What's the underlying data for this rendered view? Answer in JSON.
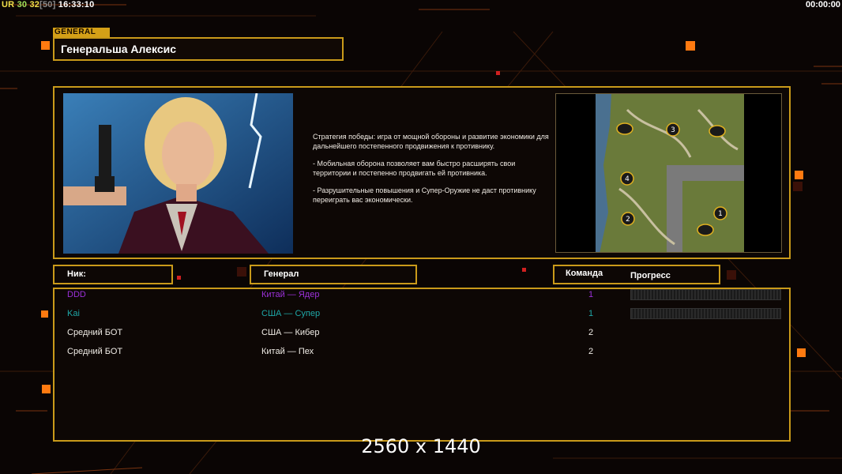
{
  "hud": {
    "ur_label": "UR",
    "fps_value": "30",
    "fps_value2": "32",
    "fps_bracket": "[50]",
    "clock": "16:33:10",
    "timer": "00:00:00"
  },
  "general": {
    "tag": "GENERAL",
    "name": "Генеральша Алексис",
    "description": [
      "Стратегия победы: игра от мощной обороны и развитие экономики для дальнейшего постепенного продвижения к противнику.",
      "- Мобильная оборона позволяет вам быстро расширять свои территории и постепенно продвигать ей противника.",
      "- Разрушительные повышения и Супер-Оружие не даст противнику переиграть вас экономически."
    ]
  },
  "minimap": {
    "markers": [
      "1",
      "2",
      "3",
      "4"
    ]
  },
  "columns": {
    "nick": "Ник:",
    "general": "Генерал",
    "team": "Команда",
    "progress": "Прогресс"
  },
  "players": [
    {
      "nick": "DDD",
      "general": "Китай — Ядер",
      "team": "1",
      "color": "#9b30d9",
      "has_progress": true
    },
    {
      "nick": "Kai",
      "general": "США — Супер",
      "team": "1",
      "color": "#1fa8a8",
      "has_progress": true
    },
    {
      "nick": "Средний БОТ",
      "general": "США — Кибер",
      "team": "2",
      "color": "#f0ece6",
      "has_progress": false
    },
    {
      "nick": "Средний БОТ",
      "general": "Китай — Пех",
      "team": "2",
      "color": "#f0ece6",
      "has_progress": false
    }
  ],
  "resolution_label": "2560 x 1440",
  "colors": {
    "accent_gold": "#c99a1a",
    "accent_orange": "#ff7a10"
  }
}
